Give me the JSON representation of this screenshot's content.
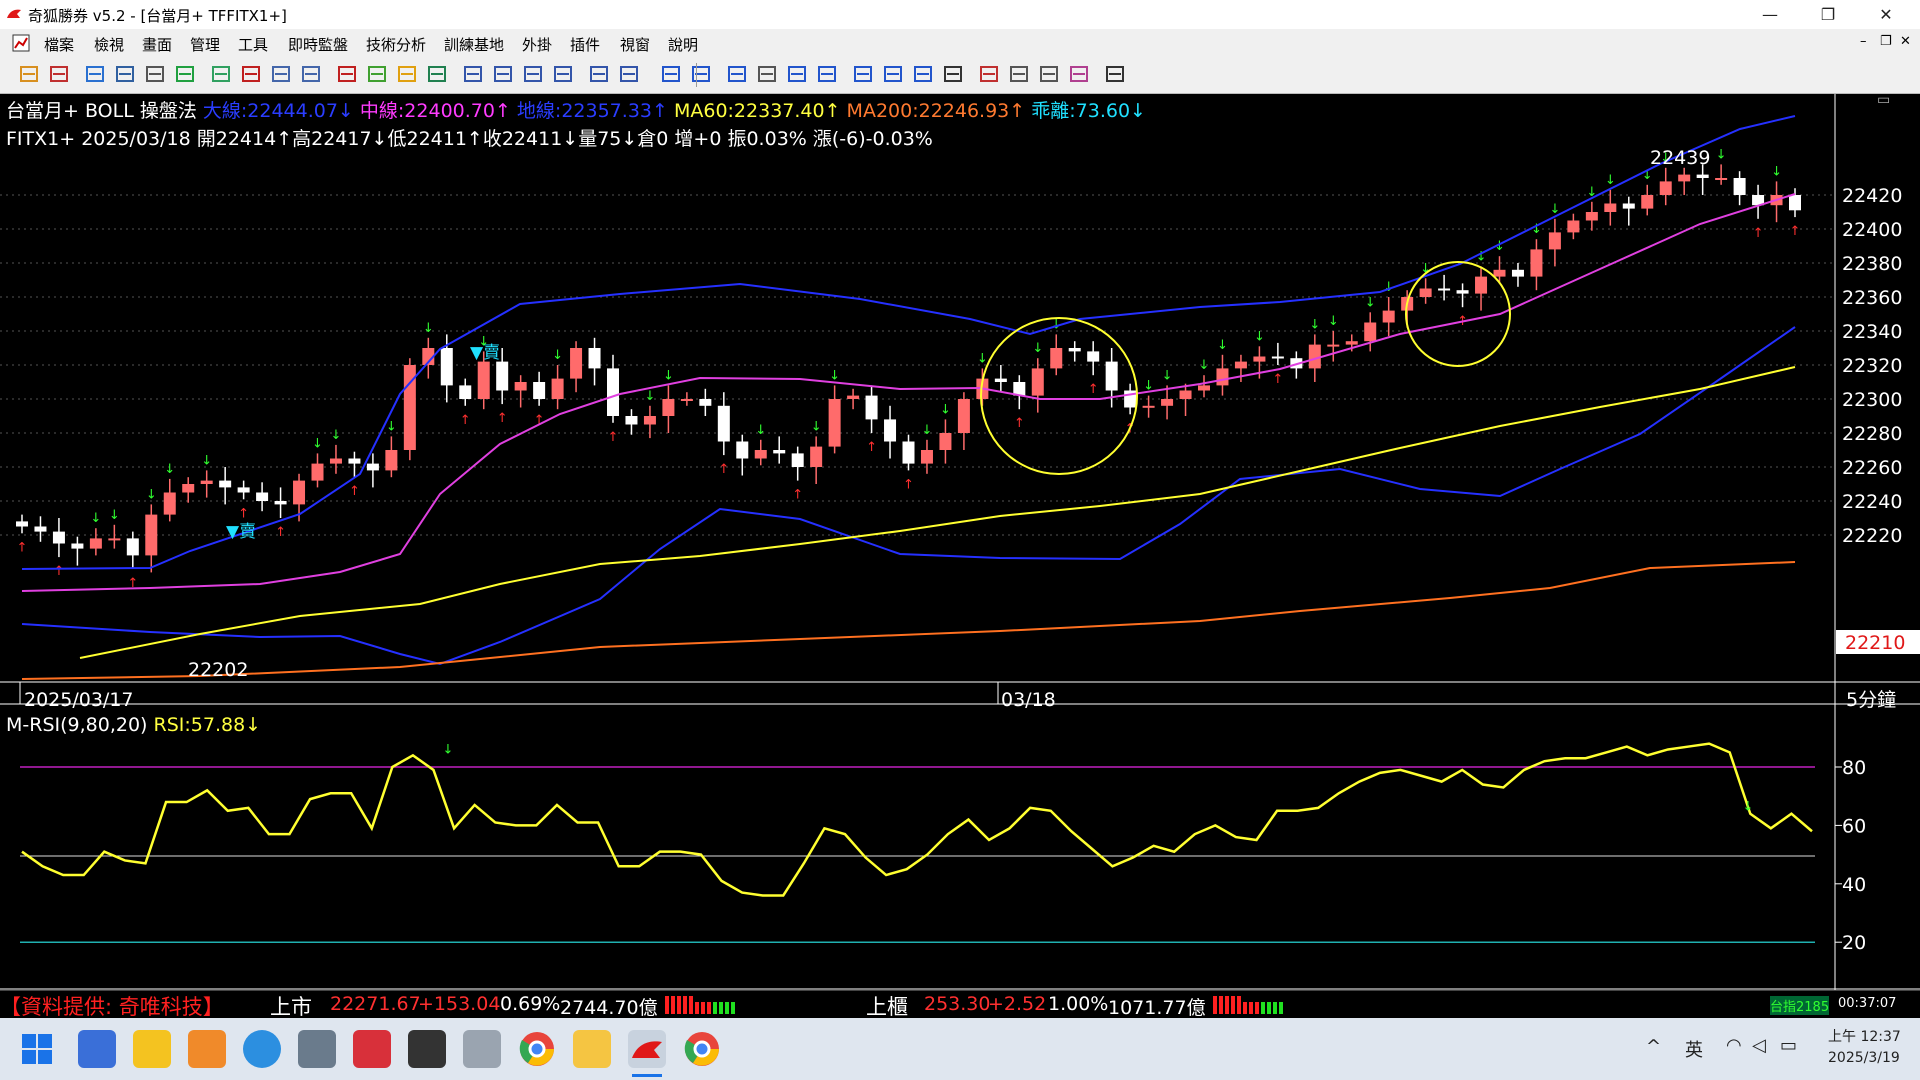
{
  "window": {
    "title": "奇狐勝券 v5.2 - [台當月+ TFFITX1+]",
    "minimize_glyph": "—",
    "restore_glyph": "❐",
    "close_glyph": "✕",
    "inner_controls": [
      "–",
      "❐",
      "✕"
    ]
  },
  "menu": [
    "檔案",
    "檢視",
    "畫面",
    "管理",
    "工具",
    "即時監盤",
    "技術分析",
    "訓練基地",
    "外掛",
    "插件",
    "視窗",
    "說明"
  ],
  "toolbar": {
    "icons": [
      "open-folder-icon",
      "quote-icon",
      "cross-icon",
      "table-icon",
      "weight-icon",
      "green-chart-icon",
      "grid-icon",
      "list-icon",
      "copy-icon",
      "doc-icon",
      "flag-icon",
      "money-icon",
      "diamond-icon",
      "tick-icon",
      "window-icon",
      "window2-icon",
      "window3-icon",
      "window4-icon",
      "window5-icon",
      "window6-icon",
      "cursor-icon",
      "line-icon",
      "fib-icon",
      "vlines-icon",
      "fan-icon",
      "channel-icon",
      "hatch-icon",
      "rect-icon",
      "ellipse-icon",
      "text-icon",
      "shape1-icon",
      "eraser-icon",
      "erase2-icon",
      "palette-icon",
      "save-icon"
    ]
  },
  "header": {
    "line1": [
      {
        "text": "台當月+ BOLL 操盤法 ",
        "color": "#ffffff"
      },
      {
        "text": "大線:22444.07↓",
        "color": "#2a3dff"
      },
      {
        "text": " 中線:22400.70↑",
        "color": "#ff3cff"
      },
      {
        "text": " 地線:22357.33↑",
        "color": "#2a3dff"
      },
      {
        "text": " MA60:22337.40↑",
        "color": "#ffff40"
      },
      {
        "text": " MA200:22246.93↑",
        "color": "#ff7a30"
      },
      {
        "text": " 乖離:73.60↓",
        "color": "#20e0ff"
      }
    ],
    "line2": "FITX1+ 2025/03/18 開22414↑高22417↓低22411↑收22411↓量75↓倉0 增+0 振0.03% 漲(-6)-0.03%"
  },
  "price_axis": {
    "labels": [
      "22420",
      "22400",
      "22380",
      "22360",
      "22340",
      "22320",
      "22300",
      "22280",
      "22260",
      "22240",
      "22220"
    ],
    "current": "22210",
    "timeframe": "5分鐘"
  },
  "time_axis": {
    "labels": [
      "2025/03/17",
      "03/18"
    ]
  },
  "annotations": {
    "high_label": "22439",
    "low_label": "22202",
    "sell_label_1": "▼賣",
    "sell_label_2": "▼賣"
  },
  "rsi": {
    "header": [
      {
        "text": "M-RSI(9,80,20) ",
        "color": "#ffffff"
      },
      {
        "text": "RSI:57.88↓",
        "color": "#ffff40"
      }
    ],
    "axis_labels": [
      "80",
      "60",
      "40",
      "20"
    ]
  },
  "status": {
    "source": "【資料提供: 奇唯科技】",
    "listed_label": "上市",
    "listed_index": "22271.67",
    "listed_change": "+153.04",
    "listed_pct": "0.69%",
    "listed_volume": "2744.70億",
    "otc_label": "上櫃",
    "otc_index": "253.30",
    "otc_change": "+2.52",
    "otc_pct": "1.00%",
    "otc_volume": "1071.77億",
    "taiex_label": "台指2185",
    "clock": "00:37:07"
  },
  "taskbar": {
    "time": "上午 12:37",
    "date": "2025/3/19",
    "ime": "英",
    "tray_up": "^"
  },
  "colors": {
    "bull": "#ff6b6b",
    "bear": "#ffffff",
    "boll_band": "#2530ff",
    "boll_mid": "#e040e0",
    "ma60": "#ffff30",
    "ma200": "#ff7020",
    "rsi": "#ffff30",
    "circle": "#ffff30"
  }
}
